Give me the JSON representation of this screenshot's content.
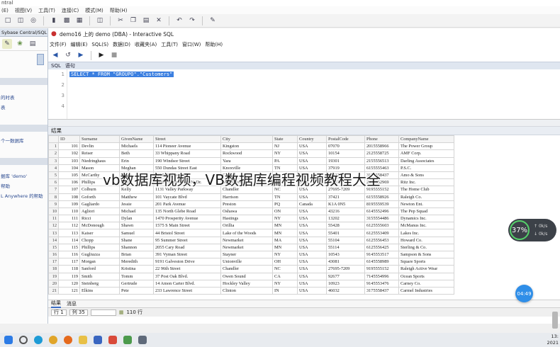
{
  "outer": {
    "title": "ntral",
    "menu": [
      "(E)",
      "视图(V)",
      "工具(T)",
      "连接(C)",
      "模式(M)",
      "帮助(H)"
    ]
  },
  "left": {
    "tab": "Sybase Central/SQL",
    "items": [
      "的时表",
      "表",
      "个一数据库",
      "据库 'demo'",
      "帮助",
      "L Anywhere 的帮助"
    ]
  },
  "window": {
    "title": "demo16 上的 demo (DBA) - Interactive SQL",
    "menu": [
      "文件(F)",
      "编辑(E)",
      "SQL(S)",
      "数据(D)",
      "收藏夹(A)",
      "工具(T)",
      "窗口(W)",
      "帮助(H)"
    ]
  },
  "sql_pane": {
    "tab_sql": "SQL",
    "tab_stmt": "语句",
    "line_numbers": [
      "1",
      "2",
      "3",
      "4"
    ],
    "query": "SELECT * FROM \"GROUPO\".\"Customers\""
  },
  "results": {
    "header": "结果",
    "columns": [
      "ID",
      "Surname",
      "GivenName",
      "Street",
      "City",
      "State",
      "Country",
      "PostalCode",
      "Phone",
      "CompanyName"
    ],
    "rows": [
      [
        "101",
        "Devlin",
        "Michaels",
        "114 Pioneer Avenue",
        "Kingston",
        "NJ",
        "USA",
        "07070",
        "2015558966",
        "The Power Group"
      ],
      [
        "102",
        "Reiser",
        "Beth",
        "33 Whippany Road",
        "Rockwood",
        "NY",
        "USA",
        "10154",
        "2125558725",
        "AMF Corp."
      ],
      [
        "103",
        "Niedringhaus",
        "Erin",
        "190 Windsor Street",
        "Yara",
        "PA",
        "USA",
        "19301",
        "2155556513",
        "Darling Associates"
      ],
      [
        "104",
        "Mason",
        "Meghan",
        "550 Dundas Street East",
        "Knoxville",
        "TN",
        "USA",
        "37919",
        "6155555463",
        "P.S.C."
      ],
      [
        "105",
        "McCarthy",
        "Laura",
        "1210 Highway 36",
        "Carmel",
        "IN",
        "USA",
        "46032",
        "3175558437",
        "Amo & Sons"
      ],
      [
        "106",
        "Phillips",
        "Paul",
        "2000 Cherry Creek N. Dr.",
        "Middletown",
        "CT",
        "USA",
        "06457",
        "2035552969",
        "Ritz Inc."
      ],
      [
        "107",
        "Colburn",
        "Kelly",
        "1131 Valley Parkway",
        "Chandler",
        "NC",
        "USA",
        "27695-7209",
        "9195555152",
        "The Home Club"
      ],
      [
        "108",
        "Goforth",
        "Matthew",
        "101 Vaycate Blvd",
        "Harrison",
        "TN",
        "USA",
        "37421",
        "6155558926",
        "Raleigh Co."
      ],
      [
        "109",
        "Gagliardo",
        "Jessie",
        "201 Park Avenue",
        "Preston",
        "PQ",
        "Canada",
        "K1A 0N5",
        "8195559539",
        "Newton Ent."
      ],
      [
        "110",
        "Agliori",
        "Michael",
        "135 North Glebe Road",
        "Oshawa",
        "ON",
        "USA",
        "43216",
        "6145552496",
        "The Pep Squad"
      ],
      [
        "111",
        "Ricci",
        "Dylan",
        "1470 Prosperity Avenue",
        "Hastings",
        "NY",
        "USA",
        "13202",
        "3155554486",
        "Dynamics Inc."
      ],
      [
        "112",
        "McDonough",
        "Shawn",
        "1575 S Main Street",
        "Orillia",
        "MN",
        "USA",
        "55428",
        "6125555603",
        "McManus Inc."
      ],
      [
        "113",
        "Kaiser",
        "Samuel",
        "44 Bristol Street",
        "Lake of the Woods",
        "MN",
        "USA",
        "55401",
        "6125553409",
        "Lakes Inc."
      ],
      [
        "114",
        "Chopp",
        "Shane",
        "95 Summer Street",
        "Newmarket",
        "MA",
        "USA",
        "55104",
        "6125556453",
        "Howard Co."
      ],
      [
        "115",
        "Phillips",
        "Shannon",
        "2055 Cary Road",
        "Newmarket",
        "MN",
        "USA",
        "55114",
        "6125556425",
        "Sterling & Co."
      ],
      [
        "116",
        "Gugliuzza",
        "Brian",
        "391 Vyman Street",
        "Stayner",
        "NY",
        "USA",
        "10543",
        "9145553517",
        "Sampson & Sons"
      ],
      [
        "117",
        "Morgan",
        "Meredith",
        "9191 Galveston Drive",
        "Unionville",
        "OH",
        "USA",
        "43081",
        "6145558989",
        "Square Sports"
      ],
      [
        "118",
        "Sanford",
        "Kristina",
        "22 96th Street",
        "Chandler",
        "NC",
        "USA",
        "27695-7209",
        "9195555152",
        "Raleigh Active Wear"
      ],
      [
        "119",
        "Smith",
        "Tomm",
        "37 Post Oak Blvd.",
        "Owen Sound",
        "CA",
        "USA",
        "92677",
        "7145554996",
        "Ocean Sports"
      ],
      [
        "120",
        "Steinberg",
        "Gertrude",
        "14 Amon Carter Blvd.",
        "Hockley Valley",
        "NY",
        "USA",
        "10923",
        "9145553476",
        "Carney Co."
      ],
      [
        "121",
        "Elkins",
        "Pete",
        "233 Lawrence Street",
        "Clinton",
        "IN",
        "USA",
        "46032",
        "3175558437",
        "Carmel Industries"
      ]
    ]
  },
  "result_tabs": [
    "结果",
    "消息"
  ],
  "status": {
    "line": "行 1",
    "col": "列 35",
    "rows": "110 行"
  },
  "caption": "vb数据库视频，VB数据库编程视频教程大全",
  "gauge": {
    "percent": "37%",
    "up": "0k/s",
    "down": "0k/s"
  },
  "float_time": "04:49",
  "clock": {
    "time": "13:",
    "date": "2021"
  },
  "colors": {
    "selection": "#3b7fe0",
    "pane_header": "#dfe6f0",
    "gauge_bg": "#3c4148",
    "gauge_ring": "#55d16a",
    "float_btn": "#2f8ee8"
  }
}
